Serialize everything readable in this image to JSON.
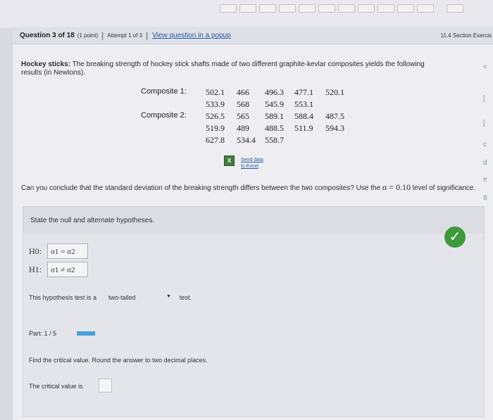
{
  "header": {
    "question_title": "Question 3 of 18",
    "points": "(1 point)",
    "attempt": "Attempt 1 of 3",
    "popup_link": "View question in a popup",
    "section": "11.4 Section Exercis"
  },
  "problem": {
    "topic": "Hockey sticks:",
    "text": "The breaking strength of hockey stick shafts made of two different graphite-kevlar composites yields the following results (in Newtons)."
  },
  "data": {
    "composite1_label": "Composite 1:",
    "composite2_label": "Composite 2:",
    "rows": [
      [
        "502.1",
        "466",
        "496.3",
        "477.1",
        "520.1"
      ],
      [
        "533.9",
        "568",
        "545.9",
        "553.1",
        ""
      ],
      [
        "526.5",
        "565",
        "589.1",
        "588.4",
        "487.5"
      ],
      [
        "519.9",
        "489",
        "488.5",
        "511.9",
        "594.3"
      ],
      [
        "627.8",
        "534.4",
        "558.7",
        "",
        ""
      ]
    ]
  },
  "excel": {
    "line1": "Send data",
    "line2": "to Excel"
  },
  "question": {
    "text_before": "Can you conclude that the standard deviation of the breaking strength differs between the two composites? Use the",
    "alpha": "α = 0.10",
    "text_after": "level of significance."
  },
  "hypotheses": {
    "heading": "State the null and alternate hypotheses.",
    "h0_label": "H0:",
    "h0_value": "σ1 = σ2",
    "h1_label": "H1:",
    "h1_value": "σ1 ≠ σ2",
    "tailed_prefix": "This hypothesis test is a",
    "tailed_value": "two-tailed",
    "tailed_suffix": "test."
  },
  "part": {
    "label": "Part: 1 / 5"
  },
  "critical": {
    "instruction": "Find the critical value. Round the answer to two decimal places.",
    "label": "The critical value is"
  },
  "colors": {
    "link": "#2758a7",
    "success": "#3c9a3a",
    "progress": "#4a9fd8"
  }
}
